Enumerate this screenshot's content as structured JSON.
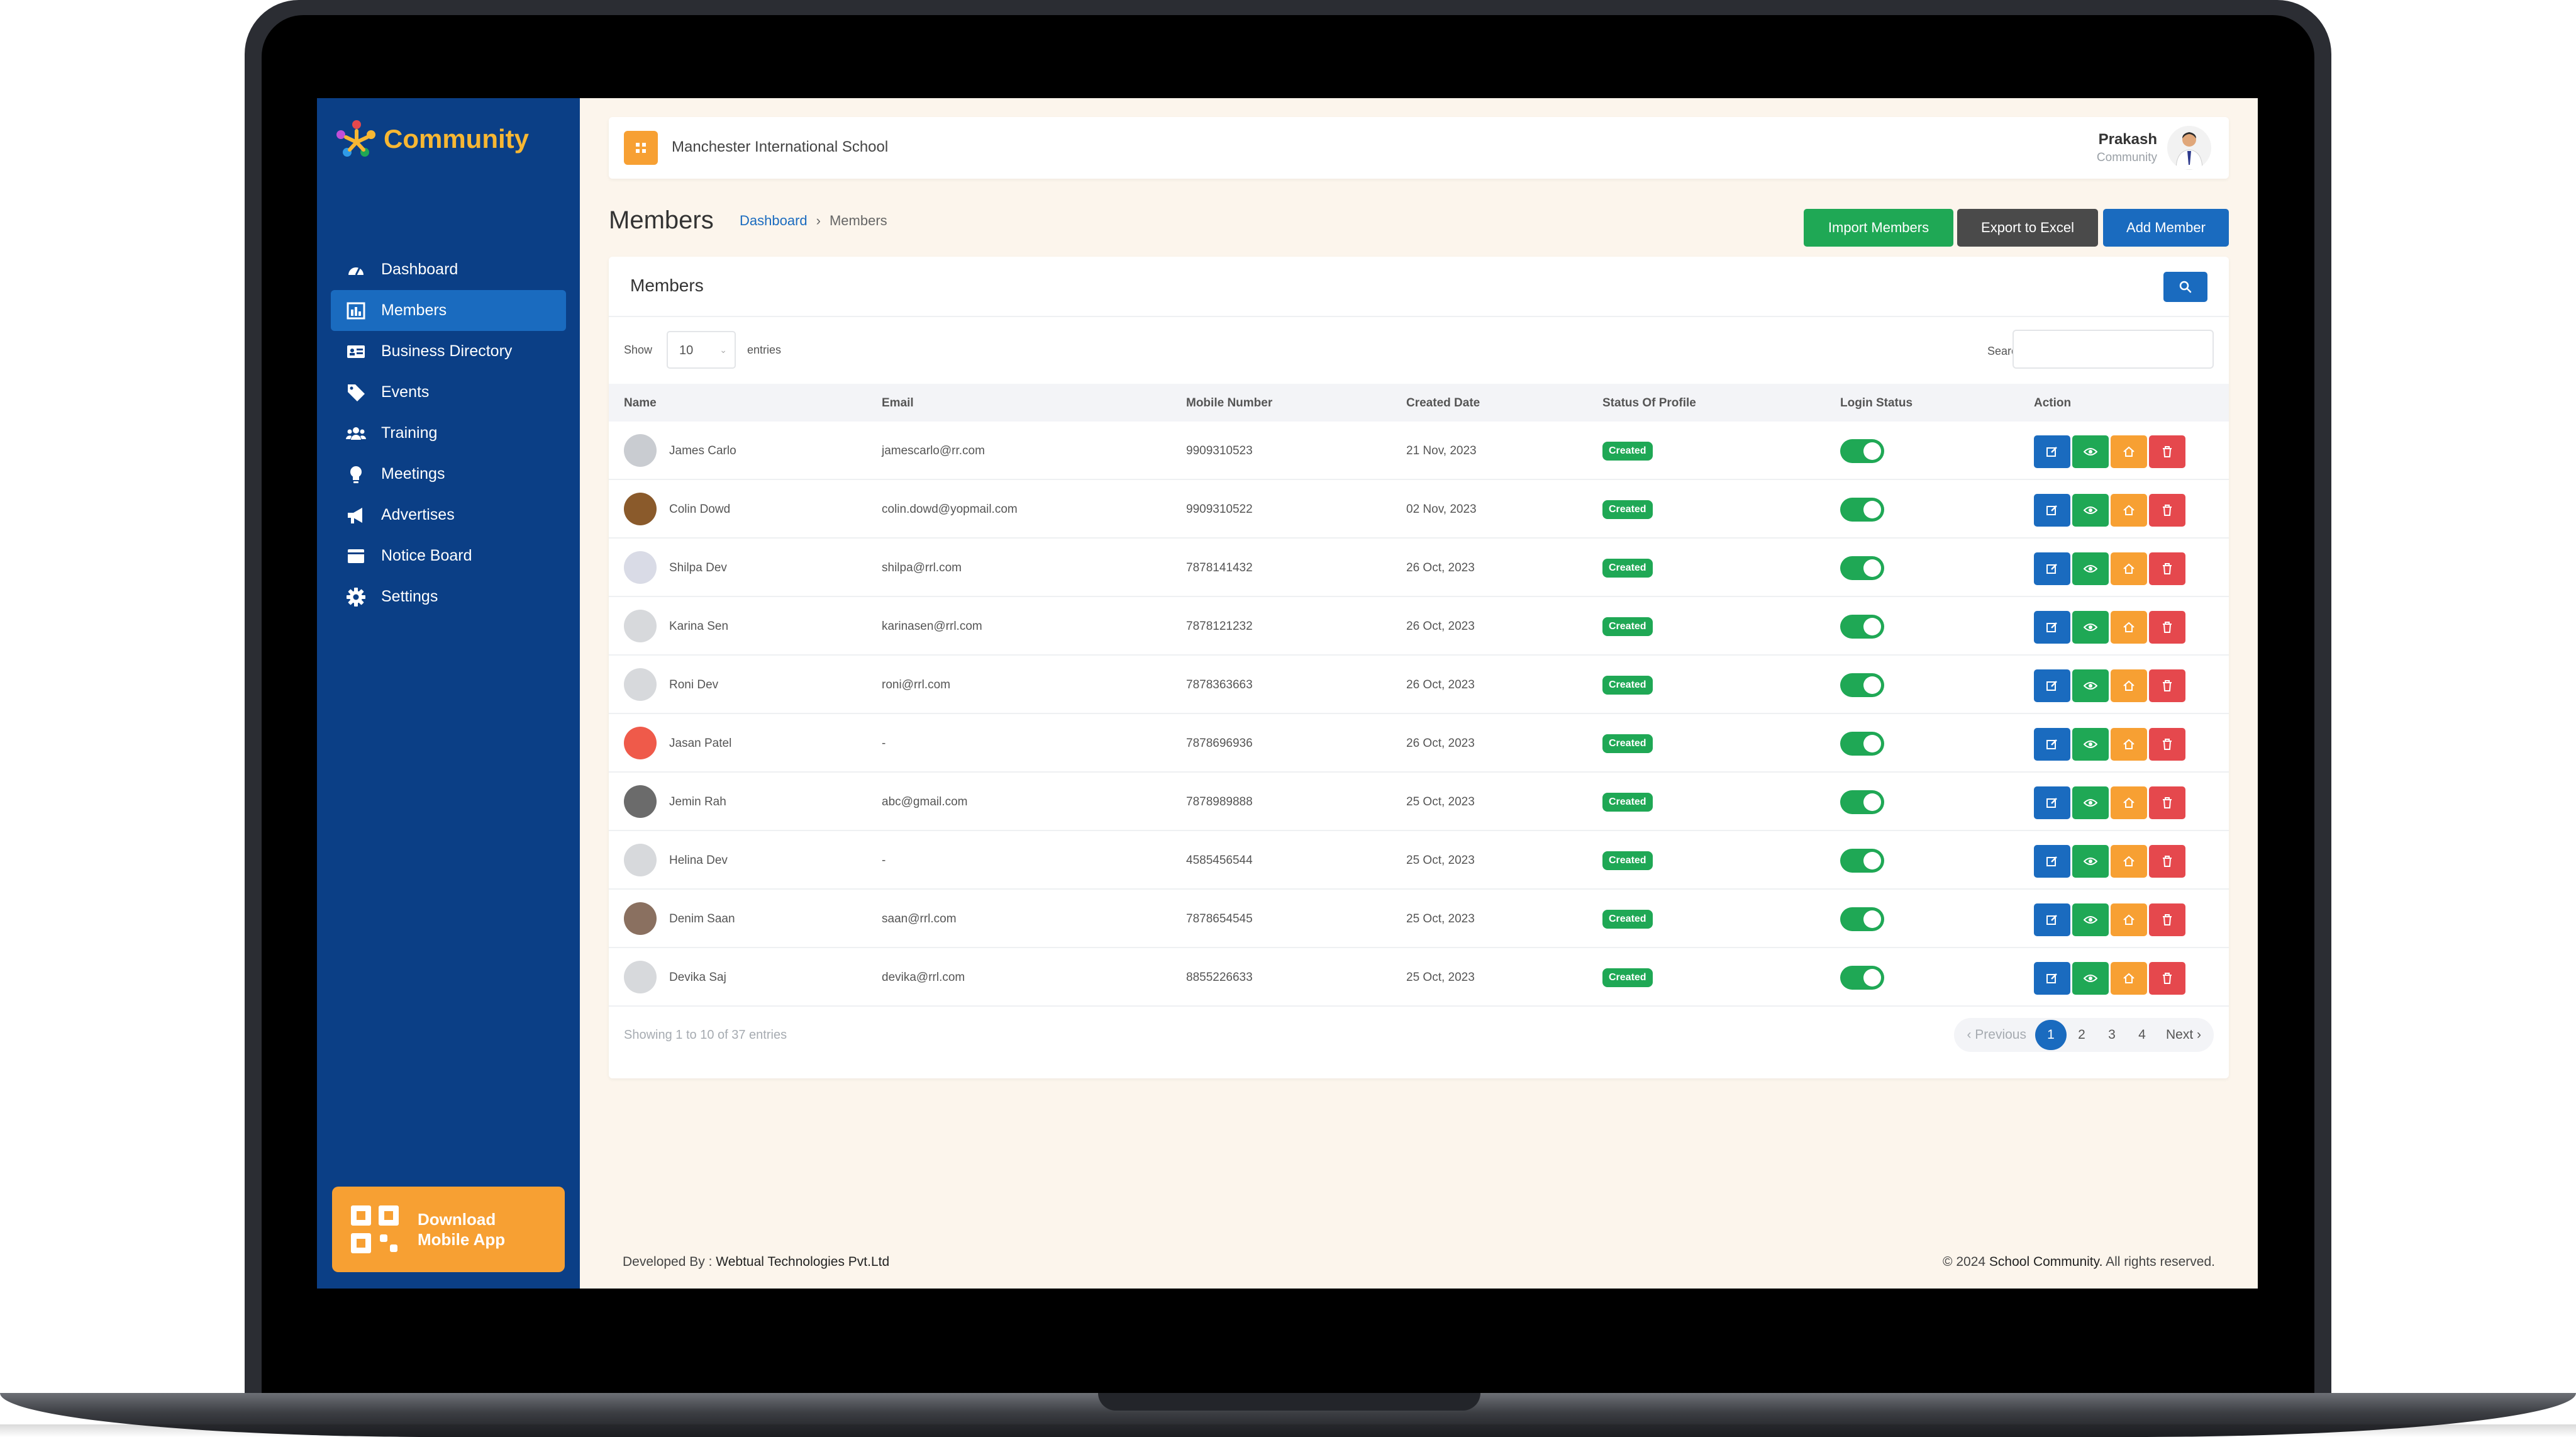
{
  "brand": {
    "name": "Community"
  },
  "sidebar": {
    "items": [
      {
        "label": "Dashboard",
        "icon": "dashboard-icon",
        "active": false
      },
      {
        "label": "Members",
        "icon": "members-icon",
        "active": true
      },
      {
        "label": "Business Directory",
        "icon": "business-directory-icon",
        "active": false
      },
      {
        "label": "Events",
        "icon": "tag-icon",
        "active": false
      },
      {
        "label": "Training",
        "icon": "users-icon",
        "active": false
      },
      {
        "label": "Meetings",
        "icon": "lightbulb-icon",
        "active": false
      },
      {
        "label": "Advertises",
        "icon": "megaphone-icon",
        "active": false
      },
      {
        "label": "Notice Board",
        "icon": "notice-board-icon",
        "active": false
      },
      {
        "label": "Settings",
        "icon": "gear-icon",
        "active": false
      }
    ],
    "download_line1": "Download",
    "download_line2": "Mobile App"
  },
  "topbar": {
    "school_name": "Manchester International School",
    "user_name": "Prakash",
    "user_role": "Community"
  },
  "page": {
    "title": "Members",
    "breadcrumb": [
      "Dashboard",
      "Members"
    ],
    "buttons": {
      "import": "Import Members",
      "export": "Export to Excel",
      "add": "Add Member"
    }
  },
  "card": {
    "title": "Members",
    "show_label": "Show",
    "page_size": "10",
    "entries_label": "entries",
    "search_label": "Search:",
    "columns": [
      "Name",
      "Email",
      "Mobile Number",
      "Created Date",
      "Status Of Profile",
      "Login Status",
      "Action"
    ],
    "rows": [
      {
        "name": "James Carlo",
        "email": "jamescarlo@rr.com",
        "mobile": "9909310523",
        "created": "21 Nov, 2023",
        "status": "Created",
        "login": true
      },
      {
        "name": "Colin Dowd",
        "email": "colin.dowd@yopmail.com",
        "mobile": "9909310522",
        "created": "02 Nov, 2023",
        "status": "Created",
        "login": true
      },
      {
        "name": "Shilpa Dev",
        "email": "shilpa@rrl.com",
        "mobile": "7878141432",
        "created": "26 Oct, 2023",
        "status": "Created",
        "login": true
      },
      {
        "name": "Karina Sen",
        "email": "karinasen@rrl.com",
        "mobile": "7878121232",
        "created": "26 Oct, 2023",
        "status": "Created",
        "login": true
      },
      {
        "name": "Roni Dev",
        "email": "roni@rrl.com",
        "mobile": "7878363663",
        "created": "26 Oct, 2023",
        "status": "Created",
        "login": true
      },
      {
        "name": "Jasan Patel",
        "email": "-",
        "mobile": "7878696936",
        "created": "26 Oct, 2023",
        "status": "Created",
        "login": true
      },
      {
        "name": "Jemin Rah",
        "email": "abc@gmail.com",
        "mobile": "7878989888",
        "created": "25 Oct, 2023",
        "status": "Created",
        "login": true
      },
      {
        "name": "Helina Dev",
        "email": "-",
        "mobile": "4585456544",
        "created": "25 Oct, 2023",
        "status": "Created",
        "login": true
      },
      {
        "name": "Denim Saan",
        "email": "saan@rrl.com",
        "mobile": "7878654545",
        "created": "25 Oct, 2023",
        "status": "Created",
        "login": true
      },
      {
        "name": "Devika Saj",
        "email": "devika@rrl.com",
        "mobile": "8855226633",
        "created": "25 Oct, 2023",
        "status": "Created",
        "login": true
      }
    ],
    "showing": "Showing 1 to 10 of 37 entries",
    "pagination": {
      "previous": "‹ Previous",
      "pages": [
        "1",
        "2",
        "3",
        "4"
      ],
      "current": "1",
      "next": "Next ›"
    }
  },
  "footer": {
    "developed_prefix": "Developed By : ",
    "developer": "Webtual Technologies Pvt.Ltd",
    "copyright_prefix": "© 2024 ",
    "copyright_owner": "School Community.",
    "copyright_suffix": " All rights reserved."
  },
  "colors": {
    "sidebar": "#0b3f86",
    "active_nav": "#1a6bbf",
    "accent_orange": "#f7a033",
    "brand_yellow": "#f7b733",
    "primary_blue": "#1a6bbf",
    "success_green": "#1fa855",
    "danger_red": "#e5484d",
    "export_dark": "#4a4a4a",
    "page_bg": "#fcf5ec"
  }
}
